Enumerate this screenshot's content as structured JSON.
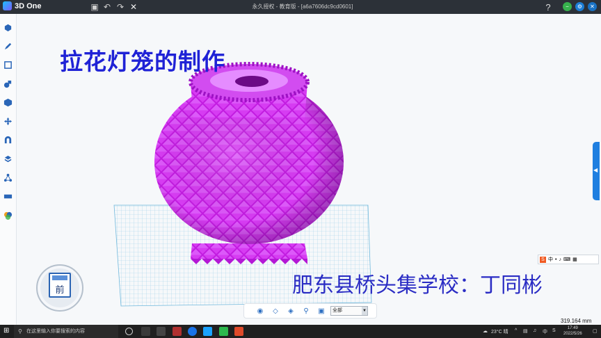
{
  "app": {
    "name": "3D One",
    "window_title": "永久授权 - 教育版 - [a6a7606dc9cd0601]"
  },
  "titlebar": {
    "help_label": "?"
  },
  "sidebar": {
    "icons": [
      "primitives-icon",
      "sketch-icon",
      "sketch-edit-icon",
      "feature-icon",
      "special-function-icon",
      "move-icon",
      "combine-icon",
      "pattern-icon",
      "mesh-icon",
      "measure-icon",
      "color-icon"
    ]
  },
  "overlay": {
    "headline": "拉花灯笼的制作",
    "school": "肥东县桥头集学校：丁同彬"
  },
  "view_cube": {
    "face_label": "前"
  },
  "bottom_toolbar": {
    "filter_value": "全部"
  },
  "status": {
    "measurement": "319.164 mm"
  },
  "ime": {
    "badge": "S",
    "mode": "中"
  },
  "taskbar": {
    "search_placeholder": "在这里输入你要搜索的内容",
    "weather": "23°C 晴",
    "time": "17:49",
    "date": "2022/5/26"
  },
  "colors": {
    "accent": "#1f7fe0",
    "model": "#c81ee6",
    "headline": "#1f22d6"
  }
}
